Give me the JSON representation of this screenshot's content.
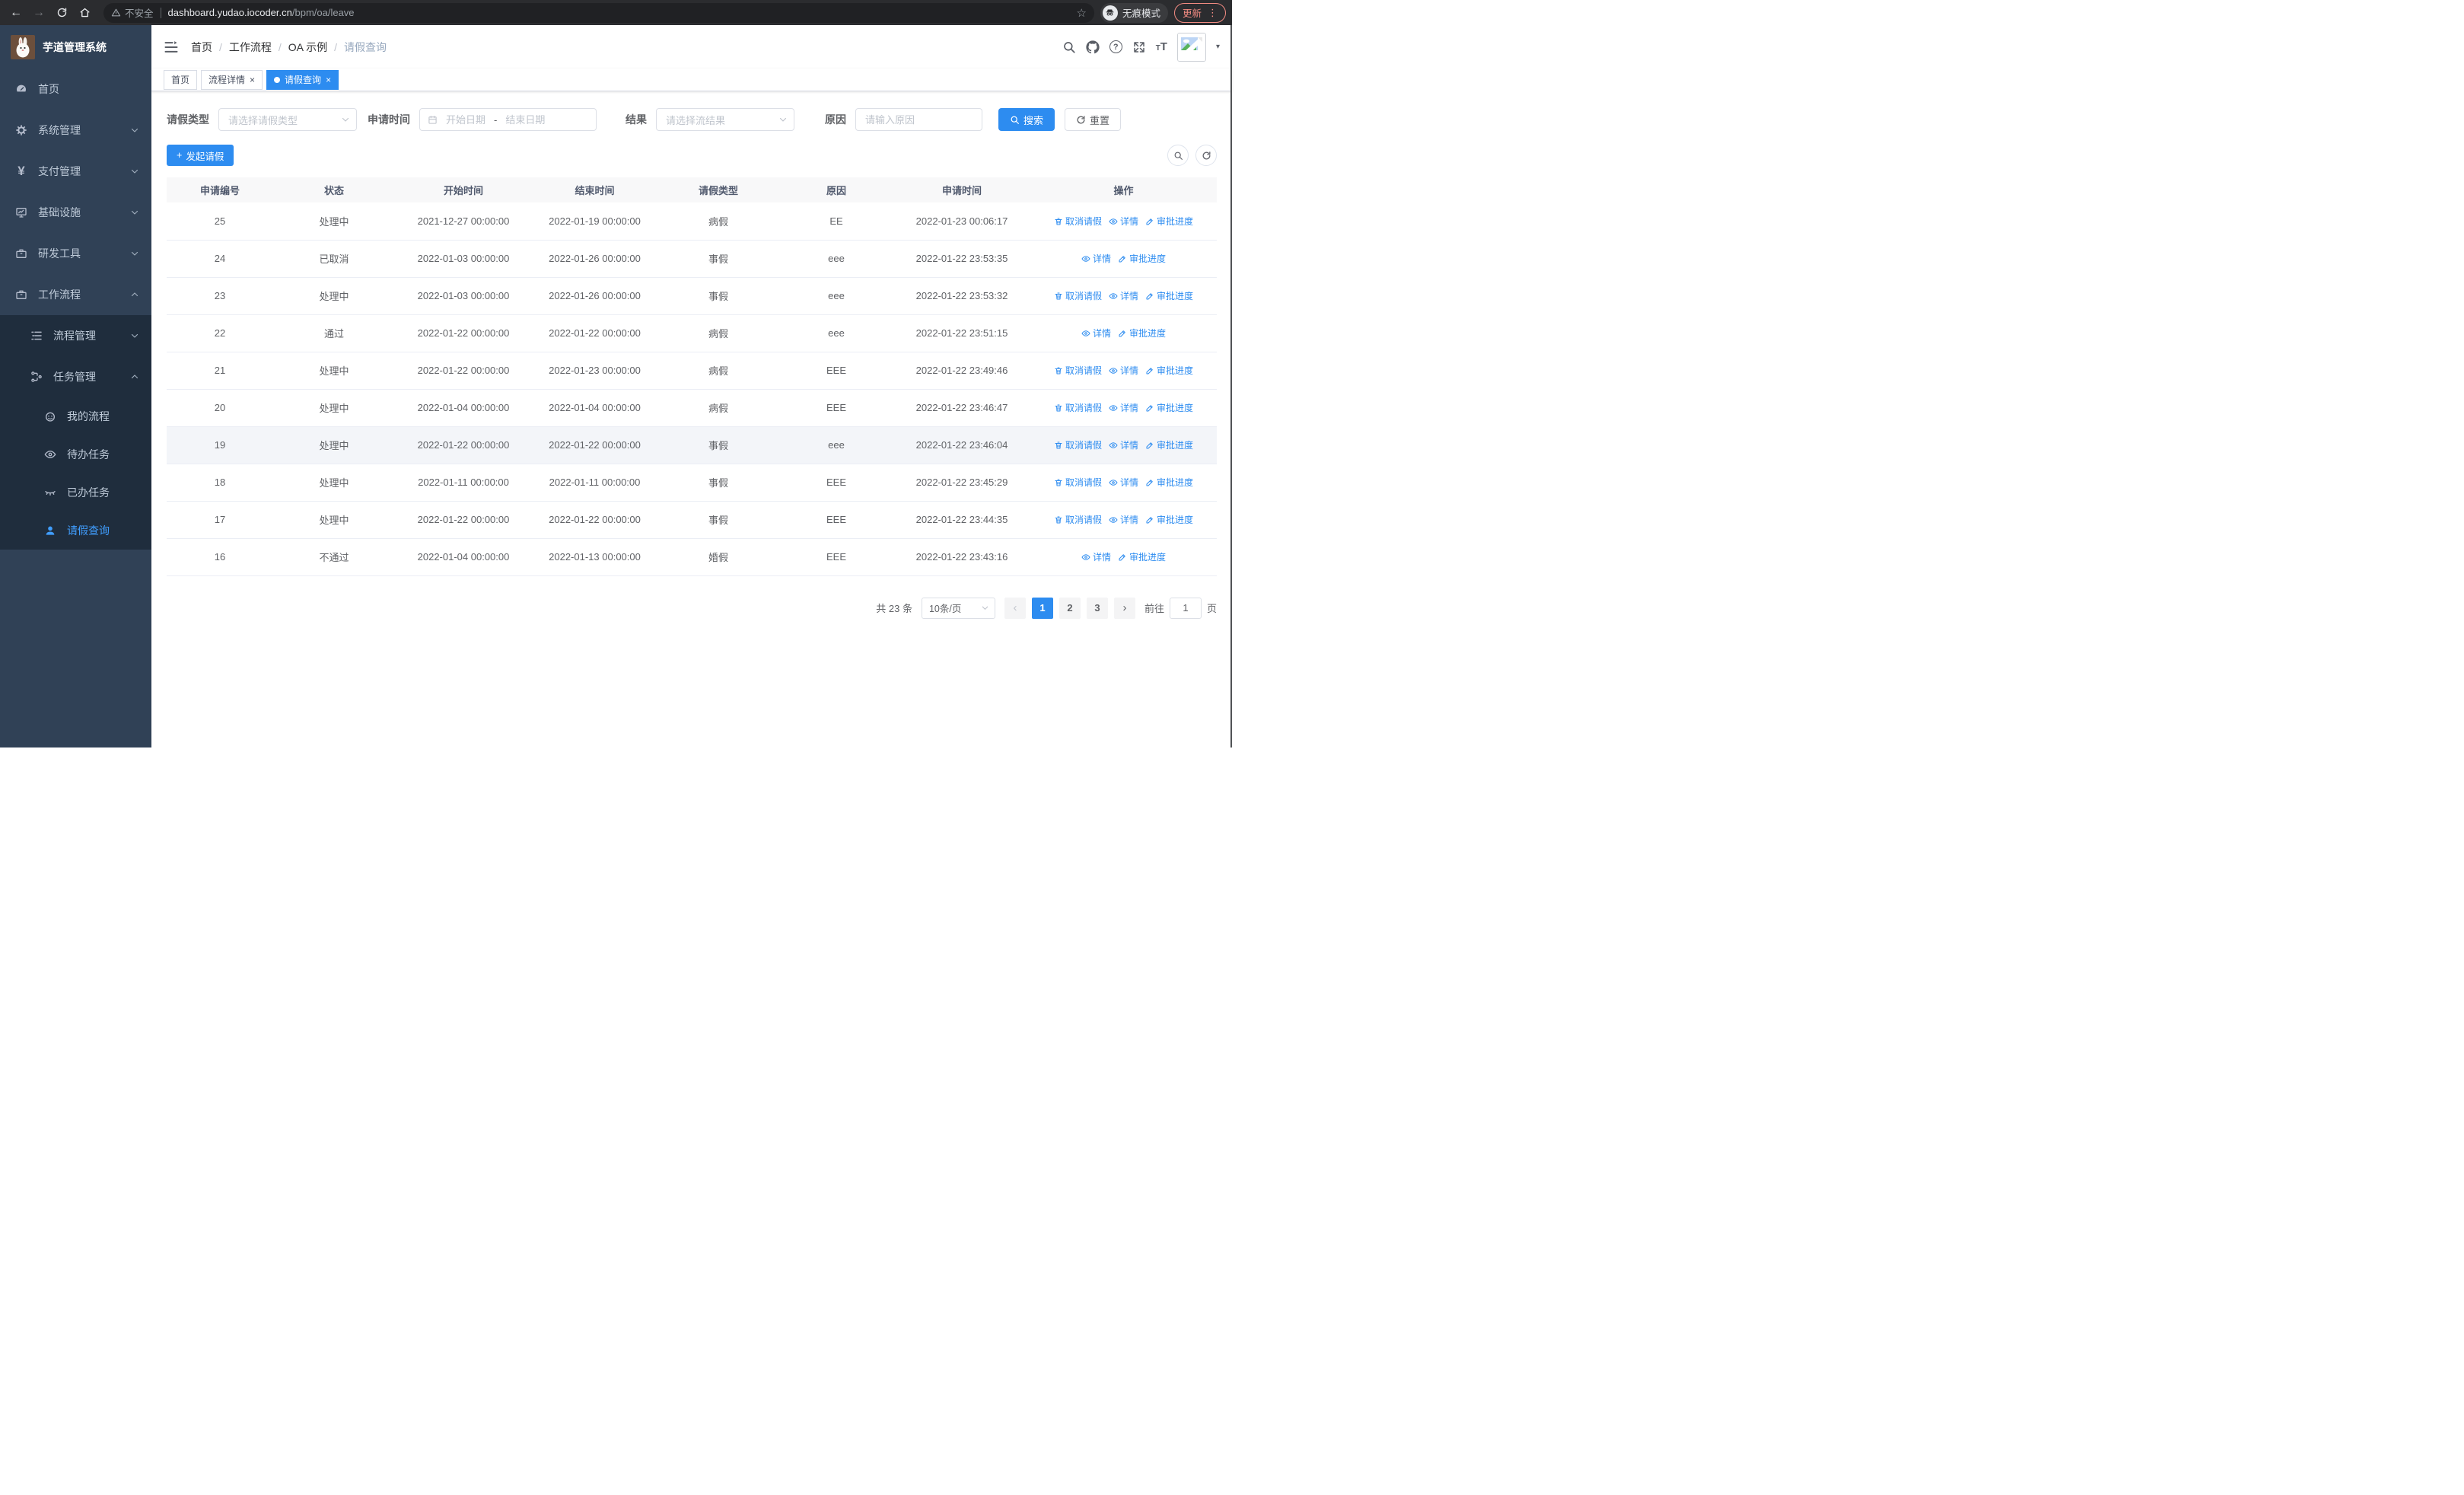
{
  "colors": {
    "accent": "#2d8cf0",
    "sidebar_bg": "#304156",
    "submenu_bg": "#1f2d3d",
    "active_menu": "#409eff",
    "update_button": "#f28b82"
  },
  "glyphs": {
    "back": "←",
    "forward": "→",
    "star": "☆",
    "kebab": "⋮",
    "close": "×",
    "plus": "+",
    "range_sep": "-",
    "crumb_sep": "/",
    "question": "?",
    "yen": "¥",
    "font_small": "T",
    "font_big": "T",
    "caret": "▾",
    "prev": "‹",
    "next": "›"
  },
  "icons": {
    "warning": "triangle-exclamation",
    "incognito": "hat-and-glasses",
    "reload": "circular-arrow",
    "home": "house",
    "search": "magnifier",
    "github": "octocat",
    "help": "question-circle",
    "fullscreen": "expand-arrows",
    "font_size": "Tt",
    "hamburger": "menu-fold",
    "dashboard": "gauge",
    "settings": "gear",
    "pay": "yen",
    "infra": "monitor",
    "tools": "toolbox",
    "workflow": "briefcase",
    "process": "indent-list",
    "task": "flow-nodes",
    "my_process": "robot-face",
    "todo": "eye-open",
    "done": "eye-closed",
    "leave": "person",
    "calendar": "calendar",
    "refresh": "refresh",
    "trash": "trash-can",
    "detail_eye": "eye",
    "edit_pen": "pen"
  },
  "browser": {
    "security": "不安全",
    "url_host": "dashboard.yudao.iocoder.cn",
    "url_path": "/bpm/oa/leave",
    "incognito": "无痕模式",
    "update": "更新"
  },
  "sidebar": {
    "title": "芋道管理系统",
    "items": [
      {
        "label": "首页"
      },
      {
        "label": "系统管理"
      },
      {
        "label": "支付管理"
      },
      {
        "label": "基础设施"
      },
      {
        "label": "研发工具"
      },
      {
        "label": "工作流程"
      },
      {
        "label": "流程管理"
      },
      {
        "label": "任务管理"
      },
      {
        "label": "我的流程"
      },
      {
        "label": "待办任务"
      },
      {
        "label": "已办任务"
      },
      {
        "label": "请假查询"
      }
    ]
  },
  "header": {
    "breadcrumb": [
      "首页",
      "工作流程",
      "OA 示例",
      "请假查询"
    ]
  },
  "tabs": [
    {
      "label": "首页"
    },
    {
      "label": "流程详情"
    },
    {
      "label": "请假查询"
    }
  ],
  "filters": {
    "type_label": "请假类型",
    "type_placeholder": "请选择请假类型",
    "time_label": "申请时间",
    "start_placeholder": "开始日期",
    "end_placeholder": "结束日期",
    "result_label": "结果",
    "result_placeholder": "请选择流结果",
    "reason_label": "原因",
    "reason_placeholder": "请输入原因",
    "search_label": "搜索",
    "reset_label": "重置"
  },
  "toolbar": {
    "create_label": "发起请假"
  },
  "actions": {
    "cancel": "取消请假",
    "detail": "详情",
    "progress": "审批进度"
  },
  "table": {
    "columns": [
      "申请编号",
      "状态",
      "开始时间",
      "结束时间",
      "请假类型",
      "原因",
      "申请时间",
      "操作"
    ],
    "rows": [
      {
        "id": "25",
        "status": "处理中",
        "start": "2021-12-27 00:00:00",
        "end": "2022-01-19 00:00:00",
        "type": "病假",
        "reason": "EE",
        "applied": "2022-01-23 00:06:17"
      },
      {
        "id": "24",
        "status": "已取消",
        "start": "2022-01-03 00:00:00",
        "end": "2022-01-26 00:00:00",
        "type": "事假",
        "reason": "eee",
        "applied": "2022-01-22 23:53:35"
      },
      {
        "id": "23",
        "status": "处理中",
        "start": "2022-01-03 00:00:00",
        "end": "2022-01-26 00:00:00",
        "type": "事假",
        "reason": "eee",
        "applied": "2022-01-22 23:53:32"
      },
      {
        "id": "22",
        "status": "通过",
        "start": "2022-01-22 00:00:00",
        "end": "2022-01-22 00:00:00",
        "type": "病假",
        "reason": "eee",
        "applied": "2022-01-22 23:51:15"
      },
      {
        "id": "21",
        "status": "处理中",
        "start": "2022-01-22 00:00:00",
        "end": "2022-01-23 00:00:00",
        "type": "病假",
        "reason": "EEE",
        "applied": "2022-01-22 23:49:46"
      },
      {
        "id": "20",
        "status": "处理中",
        "start": "2022-01-04 00:00:00",
        "end": "2022-01-04 00:00:00",
        "type": "病假",
        "reason": "EEE",
        "applied": "2022-01-22 23:46:47"
      },
      {
        "id": "19",
        "status": "处理中",
        "start": "2022-01-22 00:00:00",
        "end": "2022-01-22 00:00:00",
        "type": "事假",
        "reason": "eee",
        "applied": "2022-01-22 23:46:04"
      },
      {
        "id": "18",
        "status": "处理中",
        "start": "2022-01-11 00:00:00",
        "end": "2022-01-11 00:00:00",
        "type": "事假",
        "reason": "EEE",
        "applied": "2022-01-22 23:45:29"
      },
      {
        "id": "17",
        "status": "处理中",
        "start": "2022-01-22 00:00:00",
        "end": "2022-01-22 00:00:00",
        "type": "事假",
        "reason": "EEE",
        "applied": "2022-01-22 23:44:35"
      },
      {
        "id": "16",
        "status": "不通过",
        "start": "2022-01-04 00:00:00",
        "end": "2022-01-13 00:00:00",
        "type": "婚假",
        "reason": "EEE",
        "applied": "2022-01-22 23:43:16"
      }
    ]
  },
  "pagination": {
    "total": "共 23 条",
    "page_size": "10条/页",
    "pages": [
      "1",
      "2",
      "3"
    ],
    "active_page": "1",
    "goto_label": "前往",
    "goto_value": "1",
    "goto_unit": "页"
  }
}
